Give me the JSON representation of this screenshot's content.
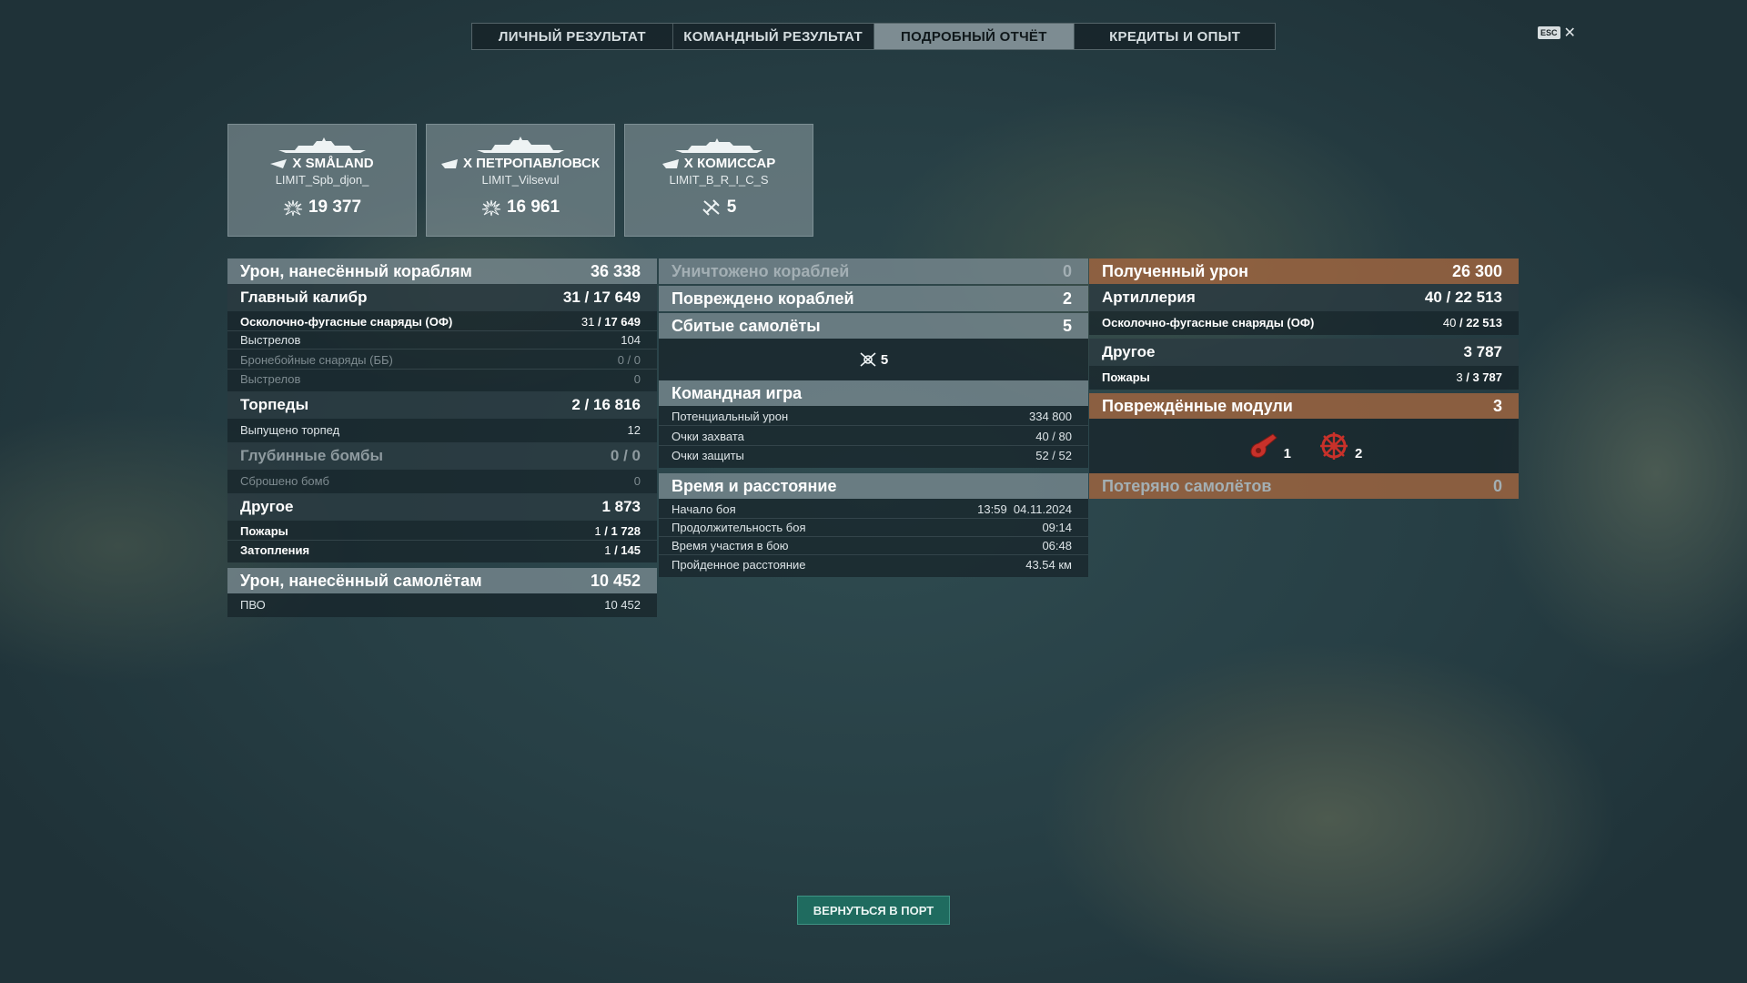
{
  "tabs": [
    "ЛИЧНЫЙ РЕЗУЛЬТАТ",
    "КОМАНДНЫЙ РЕЗУЛЬТАТ",
    "ПОДРОБНЫЙ ОТЧЁТ",
    "КРЕДИТЫ И ОПЫТ"
  ],
  "active_tab": "ПОДРОБНЫЙ ОТЧЁТ",
  "esc": {
    "key": "ESC",
    "close": "✕"
  },
  "cards": [
    {
      "ship": "X SMÅLAND",
      "player": "LIMIT_Spb_djon_",
      "value": "19 377",
      "icon": "damage-burst-icon"
    },
    {
      "ship": "X ПЕТРОПАВЛОВСК",
      "player": "LIMIT_Vilsevul",
      "value": "16 961",
      "icon": "damage-burst-icon"
    },
    {
      "ship": "X КОМИССАР",
      "player": "LIMIT_B_R_I_C_S",
      "value": "5",
      "icon": "plane-shot-icon"
    }
  ],
  "col1": {
    "damage_ships": {
      "label": "Урон, нанесённый кораблям",
      "value": "36 338"
    },
    "main_caliber": {
      "label": "Главный калибр",
      "a": "31",
      "b": "17 649"
    },
    "he": {
      "label": "Осколочно-фугасные снаряды (ОФ)",
      "a": "31",
      "b": "17 649"
    },
    "he_shots": {
      "label": "Выстрелов",
      "value": "104"
    },
    "ap": {
      "label": "Бронебойные снаряды (ББ)",
      "value": "0 / 0"
    },
    "ap_shots": {
      "label": "Выстрелов",
      "value": "0"
    },
    "torpedoes": {
      "label": "Торпеды",
      "a": "2",
      "b": "16 816"
    },
    "torp_launched": {
      "label": "Выпущено торпед",
      "value": "12"
    },
    "depth": {
      "label": "Глубинные бомбы",
      "value": "0 / 0"
    },
    "depth_dropped": {
      "label": "Сброшено бомб",
      "value": "0"
    },
    "other": {
      "label": "Другое",
      "value": "1 873"
    },
    "fires": {
      "label": "Пожары",
      "a": "1",
      "b": "1 728"
    },
    "floods": {
      "label": "Затопления",
      "a": "1",
      "b": "145"
    },
    "damage_planes": {
      "label": "Урон, нанесённый самолётам",
      "value": "10 452"
    },
    "aa": {
      "label": "ПВО",
      "value": "10 452"
    }
  },
  "col2": {
    "destroyed": {
      "label": "Уничтожено кораблей",
      "value": "0"
    },
    "damaged": {
      "label": "Повреждено кораблей",
      "value": "2"
    },
    "planes": {
      "label": "Сбитые самолёты",
      "value": "5"
    },
    "planes_icon_count": "5",
    "team": {
      "label": "Командная игра"
    },
    "potential": {
      "label": "Потенциальный урон",
      "value": "334 800"
    },
    "capture": {
      "label": "Очки захвата",
      "value": "40 / 80"
    },
    "defense": {
      "label": "Очки защиты",
      "value": "52 / 52"
    },
    "time": {
      "label": "Время и расстояние"
    },
    "start": {
      "label": "Начало боя",
      "value": "13:59  04.11.2024"
    },
    "duration": {
      "label": "Продолжительность боя",
      "value": "09:14"
    },
    "participation": {
      "label": "Время участия в бою",
      "value": "06:48"
    },
    "distance": {
      "label": "Пройденное расстояние",
      "value": "43.54 км"
    }
  },
  "col3": {
    "received": {
      "label": "Полученный урон",
      "value": "26 300"
    },
    "artillery": {
      "label": "Артиллерия",
      "a": "40",
      "b": "22 513"
    },
    "he": {
      "label": "Осколочно-фугасные снаряды (ОФ)",
      "a": "40",
      "b": "22 513"
    },
    "other": {
      "label": "Другое",
      "value": "3 787"
    },
    "fires": {
      "label": "Пожары",
      "a": "3",
      "b": "3 787"
    },
    "modules": {
      "label": "Повреждённые модули",
      "value": "3"
    },
    "module_items": [
      {
        "icon": "turret-icon",
        "count": "1"
      },
      {
        "icon": "steering-wheel-icon",
        "count": "2"
      }
    ],
    "planes_lost": {
      "label": "Потеряно самолётов",
      "value": "0"
    }
  },
  "port_button": "ВЕРНУТЬСЯ В ПОРТ",
  "colors": {
    "active_tab": "#7d8c92",
    "orange_header": "#9c6440",
    "port_button": "#1f6b5f",
    "module_icon": "#c8312a"
  }
}
